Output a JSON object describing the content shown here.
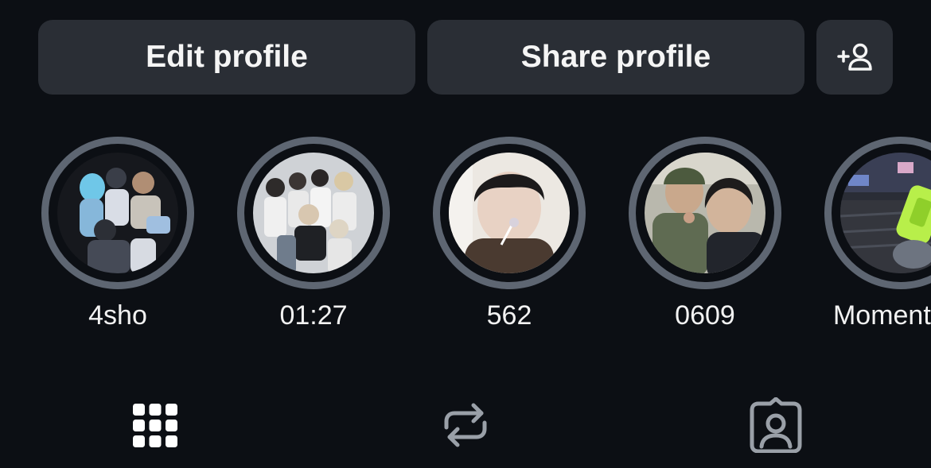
{
  "actions": {
    "edit_label": "Edit profile",
    "share_label": "Share profile",
    "add_person_icon": "add-person-icon"
  },
  "highlights": [
    {
      "label": "4sho"
    },
    {
      "label": "01:27"
    },
    {
      "label": "562"
    },
    {
      "label": "0609"
    },
    {
      "label": "Momentum"
    }
  ],
  "tabs": [
    {
      "icon": "grid-icon",
      "active": true
    },
    {
      "icon": "repost-icon",
      "active": false
    },
    {
      "icon": "tagged-person-icon",
      "active": false
    }
  ],
  "colors": {
    "background": "#0c0f14",
    "button": "#2a2e35",
    "ring": "#5e6672",
    "text": "#f5f5f5",
    "inactive_icon": "#9aa0a8"
  }
}
